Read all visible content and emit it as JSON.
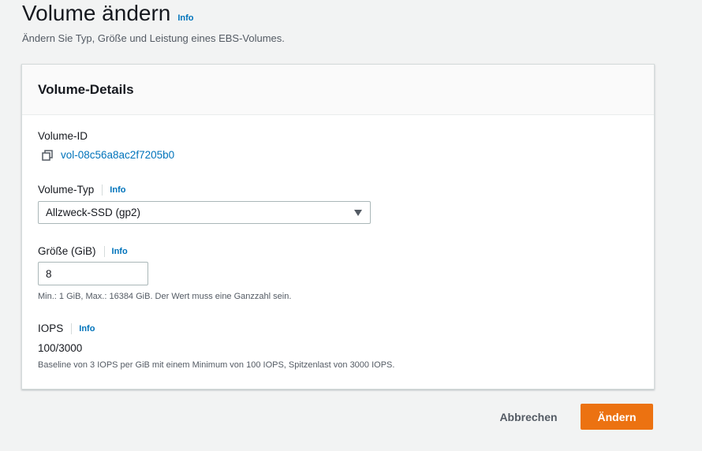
{
  "page": {
    "title": "Volume ändern",
    "title_info": "Info",
    "description": "Ändern Sie Typ, Größe und Leistung eines EBS-Volumes."
  },
  "panel": {
    "heading": "Volume-Details",
    "volume_id": {
      "label": "Volume-ID",
      "value": "vol-08c56a8ac2f7205b0",
      "icon": "copy-icon"
    },
    "volume_type": {
      "label": "Volume-Typ",
      "info": "Info",
      "selected": "Allzweck-SSD (gp2)"
    },
    "size": {
      "label": "Größe (GiB)",
      "info": "Info",
      "value": "8",
      "hint": "Min.: 1 GiB, Max.: 16384 GiB. Der Wert muss eine Ganzzahl sein."
    },
    "iops": {
      "label": "IOPS",
      "info": "Info",
      "value": "100/3000",
      "hint": "Baseline von 3 IOPS per GiB mit einem Minimum von 100 IOPS, Spitzenlast von 3000 IOPS."
    }
  },
  "actions": {
    "cancel": "Abbrechen",
    "submit": "Ändern"
  },
  "colors": {
    "accent": "#ec7211",
    "link": "#0073bb"
  }
}
